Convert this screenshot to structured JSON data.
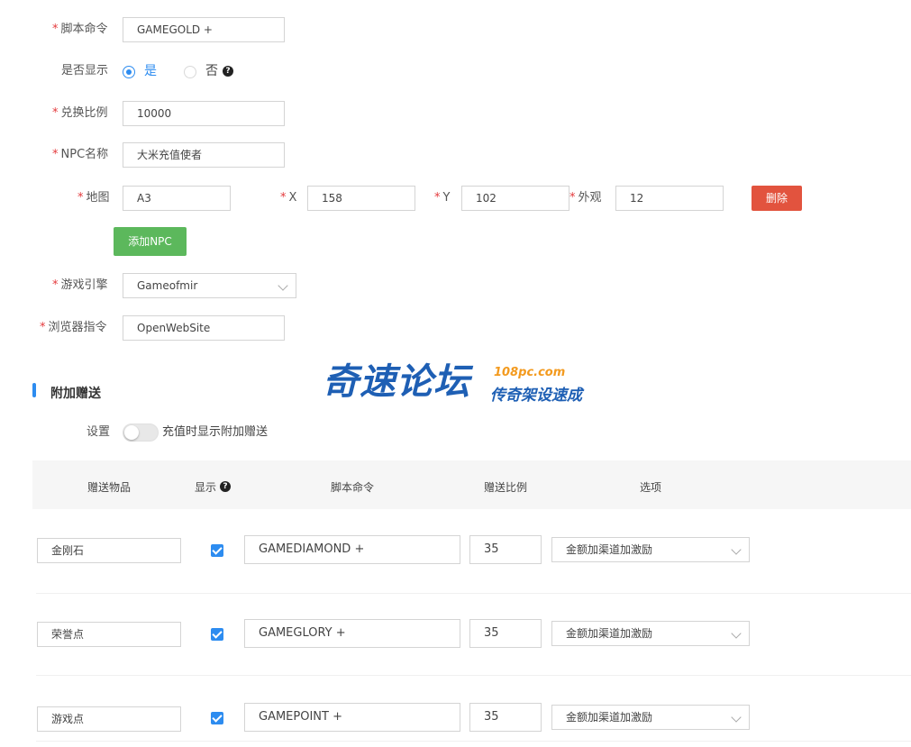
{
  "form": {
    "script_cmd": {
      "label": "脚本命令",
      "value": "GAMEGOLD +"
    },
    "show": {
      "label": "是否显示",
      "yes": "是",
      "no": "否",
      "selected": "yes"
    },
    "ratio": {
      "label": "兑换比例",
      "value": "10000"
    },
    "npc_name": {
      "label": "NPC名称",
      "value": "大米充值使者"
    },
    "npc_pos": {
      "map_label": "地图",
      "map_value": "A3",
      "x_label": "X",
      "x_value": "158",
      "y_label": "Y",
      "y_value": "102",
      "look_label": "外观",
      "look_value": "12",
      "delete_button": "删除"
    },
    "add_npc_button": "添加NPC",
    "engine": {
      "label": "游戏引擎",
      "value": "Gameofmir"
    },
    "browser_cmd": {
      "label": "浏览器指令",
      "value": "OpenWebSite"
    }
  },
  "bonus": {
    "title": "附加赠送",
    "setting_label": "设置",
    "toggle_label": "充值时显示附加赠送",
    "toggle_on": false,
    "columns": [
      "赠送物品",
      "显示",
      "脚本命令",
      "赠送比例",
      "选项"
    ],
    "rows": [
      {
        "item": "金刚石",
        "show": true,
        "cmd": "GAMEDIAMOND +",
        "ratio": "35",
        "option": "金额加渠道加激励"
      },
      {
        "item": "荣誉点",
        "show": true,
        "cmd": "GAMEGLORY +",
        "ratio": "35",
        "option": "金额加渠道加激励"
      },
      {
        "item": "游戏点",
        "show": true,
        "cmd": "GAMEPOINT +",
        "ratio": "35",
        "option": "金额加渠道加激励"
      }
    ]
  },
  "watermark": {
    "main": "奇速论坛",
    "url": "108pc.com",
    "sub": "传奇架设速成"
  },
  "colors": {
    "accent": "#2d8cf0",
    "danger": "#e2533e",
    "success": "#5cb85c",
    "required": "#e4393c"
  }
}
